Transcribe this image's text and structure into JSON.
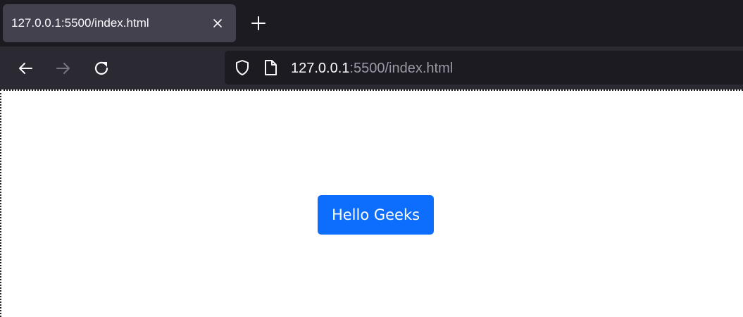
{
  "tab": {
    "title": "127.0.0.1:5500/index.html",
    "close_icon": "close-icon",
    "new_tab_icon": "plus-icon"
  },
  "nav": {
    "back_icon": "arrow-left-icon",
    "forward_icon": "arrow-right-icon",
    "reload_icon": "reload-icon"
  },
  "urlbar": {
    "host": "127.0.0.1",
    "path": ":5500/index.html",
    "security_icon": "shield-icon",
    "page_icon": "page-icon"
  },
  "page": {
    "button_label": "Hello Geeks",
    "button_color": "#0d6efd"
  },
  "colors": {
    "tabstrip": "#1c1b22",
    "active_tab": "#42414d",
    "toolbar": "#2b2a33",
    "urlbar": "#1c1b22"
  }
}
